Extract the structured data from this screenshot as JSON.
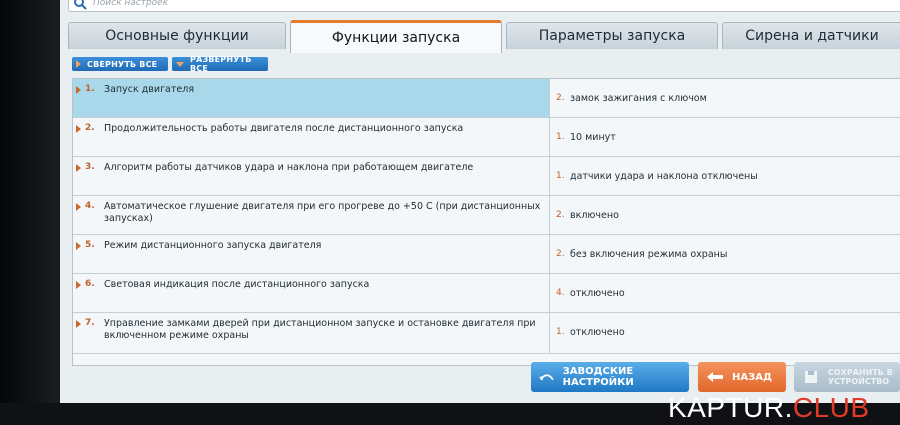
{
  "search": {
    "placeholder": "Поиск настроек"
  },
  "tabs": [
    {
      "label": "Основные функции"
    },
    {
      "label": "Функции запуска"
    },
    {
      "label": "Параметры запуска"
    },
    {
      "label": "Сирена и датчики"
    }
  ],
  "actions": {
    "collapse_all": "СВЕРНУТЬ ВСЕ",
    "expand_all": "РАЗВЕРНУТЬ ВСЕ"
  },
  "rows": [
    {
      "num": "1.",
      "label": "Запуск двигателя",
      "value_num": "2.",
      "value": "замок зажигания с ключом"
    },
    {
      "num": "2.",
      "label": "Продолжительность работы двигателя после дистанционного запуска",
      "value_num": "1.",
      "value": "10 минут"
    },
    {
      "num": "3.",
      "label": "Алгоритм работы датчиков удара и наклона при работающем двигателе",
      "value_num": "1.",
      "value": "датчики удара и наклона отключены"
    },
    {
      "num": "4.",
      "label": "Автоматическое глушение двигателя при его прогреве до +50 С (при дистанционных запусках)",
      "value_num": "2.",
      "value": "включено"
    },
    {
      "num": "5.",
      "label": "Режим дистанционного запуска двигателя",
      "value_num": "2.",
      "value": "без включения режима охраны"
    },
    {
      "num": "6.",
      "label": "Световая индикация после дистанционного запуска",
      "value_num": "4.",
      "value": "отключено"
    },
    {
      "num": "7.",
      "label": "Управление замками дверей при дистанционном запуске и остановке двигателя при включенном режиме охраны",
      "value_num": "1.",
      "value": "отключено"
    }
  ],
  "bottom": {
    "factory": "ЗАВОДСКИЕ НАСТРОЙКИ",
    "back": "НАЗАД",
    "save": "СОХРАНИТЬ В УСТРОЙСТВО"
  },
  "watermark": {
    "main": "KAPTUR.",
    "club": "CLUB"
  },
  "colors": {
    "accent": "#e67a2e",
    "selected": "#a9d8ea",
    "button_blue": "#1f78c4",
    "button_orange": "#e2672c"
  }
}
